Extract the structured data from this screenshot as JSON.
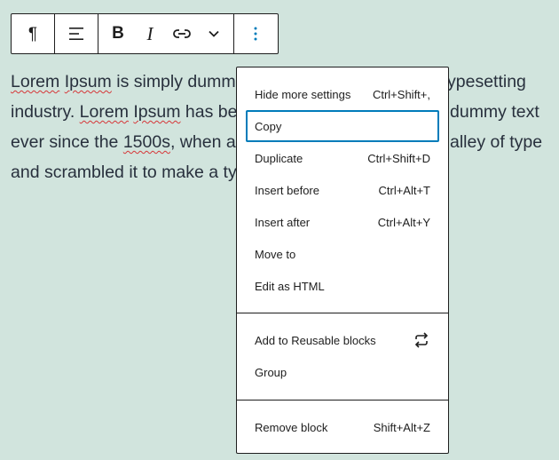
{
  "toolbar": {
    "paragraph_icon": "pilcrow-icon",
    "align_icon": "align-left-icon",
    "bold_label": "B",
    "italic_label": "I",
    "link_icon": "link-icon",
    "more_formats_icon": "chevron-down-icon",
    "options_icon": "more-vertical-icon"
  },
  "paragraph": {
    "w1": "Lorem",
    "w2": "Ipsum",
    "t1": " is simply dumm",
    "t2": "ypesetting",
    "t3": "industry. ",
    "w3": "Lorem",
    "t4": " ",
    "w4": "Ipsum",
    "t5": " has be",
    "t6": "dummy text",
    "t7": "ever since the ",
    "w5": "1500s",
    "t8": ", when a",
    "t9": "alley of type",
    "t10": "and scrambled it to make a ty"
  },
  "menu": {
    "group1": [
      {
        "label": "Hide more settings",
        "shortcut": "Ctrl+Shift+,"
      },
      {
        "label": "Copy",
        "shortcut": ""
      },
      {
        "label": "Duplicate",
        "shortcut": "Ctrl+Shift+D"
      },
      {
        "label": "Insert before",
        "shortcut": "Ctrl+Alt+T"
      },
      {
        "label": "Insert after",
        "shortcut": "Ctrl+Alt+Y"
      },
      {
        "label": "Move to",
        "shortcut": ""
      },
      {
        "label": "Edit as HTML",
        "shortcut": ""
      }
    ],
    "group2": [
      {
        "label": "Add to Reusable blocks",
        "icon": "reusable-block-icon"
      },
      {
        "label": "Group"
      }
    ],
    "group3": [
      {
        "label": "Remove block",
        "shortcut": "Shift+Alt+Z"
      }
    ]
  },
  "colors": {
    "background": "#d1e4dd",
    "text": "#28303d",
    "focus": "#007cba",
    "border": "#1e1e1e"
  }
}
